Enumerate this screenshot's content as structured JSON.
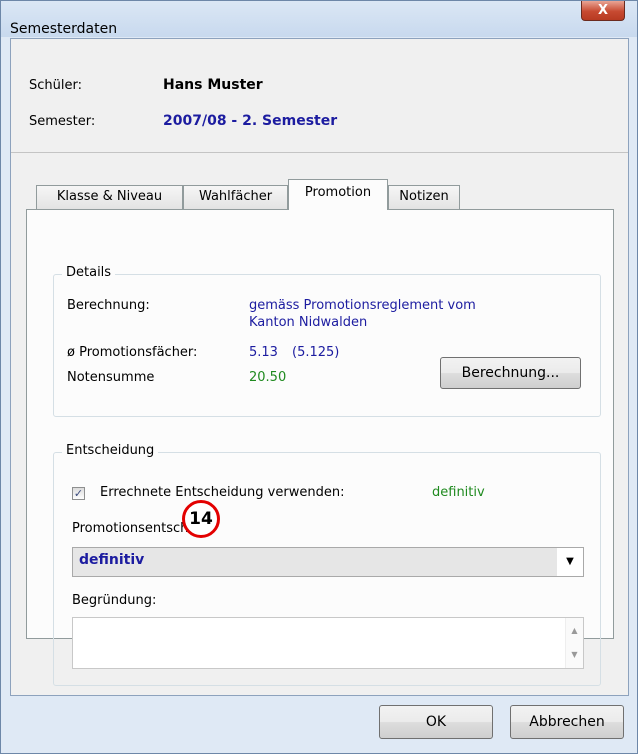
{
  "window": {
    "title": "Semesterdaten",
    "close_label": "X"
  },
  "header": {
    "student_label": "Schüler:",
    "student_value": "Hans Muster",
    "semester_label": "Semester:",
    "semester_value": "2007/08 - 2. Semester"
  },
  "tabs": [
    {
      "label": "Klasse & Niveau",
      "active": false
    },
    {
      "label": "Wahlfächer",
      "active": false
    },
    {
      "label": "Promotion",
      "active": true
    },
    {
      "label": "Notizen",
      "active": false
    }
  ],
  "details": {
    "title": "Details",
    "calc_label": "Berechnung:",
    "calc_value_line1": "gemäss Promotionsreglement vom",
    "calc_value_line2": "Kanton Nidwalden",
    "avg_label": "ø Promotionsfächer:",
    "avg_value": "5.13",
    "avg_exact": "(5.125)",
    "sum_label": "Notensumme",
    "sum_value": "20.50",
    "calc_button": "Berechnung..."
  },
  "decision": {
    "title": "Entscheidung",
    "use_calc_label": "Errechnete Entscheidung verwenden:",
    "use_calc_checked": true,
    "use_calc_value": "definitiv",
    "promo_label": "Promotionsentscheid:",
    "promo_selected": "definitiv",
    "reason_label": "Begründung:",
    "reason_value": ""
  },
  "annotation": {
    "marker": "14"
  },
  "footer": {
    "ok_label": "OK",
    "cancel_label": "Abbrechen"
  },
  "colors": {
    "value_blue": "#1c1ca0",
    "value_green": "#1f8a1f",
    "marker_red": "#e30000"
  }
}
